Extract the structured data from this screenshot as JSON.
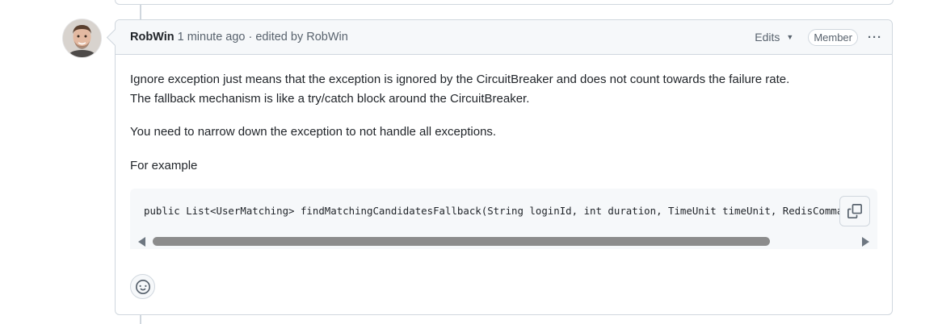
{
  "comment": {
    "author": "RobWin",
    "meta": "1 minute ago · edited by RobWin",
    "edits_label": "Edits",
    "role_badge": "Member",
    "more_actions": "···",
    "body": {
      "line1": "Ignore exception just means that the exception is ignored by the CircuitBreaker and does not count towards the failure rate.",
      "line2": "The fallback mechanism is like a try/catch block around the CircuitBreaker.",
      "paragraph2": "You need to narrow down the exception to not handle all exceptions.",
      "paragraph3": "For example",
      "code": "public List<UserMatching> findMatchingCandidatesFallback(String loginId, int duration, TimeUnit timeUnit, RedisCommandTimeoutException ex) {"
    }
  },
  "icons": {
    "copy": "copy-icon",
    "emoji": "smiley-icon",
    "caret": "triangle-down-icon",
    "kebab": "kebab-horizontal-icon"
  },
  "colors": {
    "border": "#d0d7de",
    "header_bg": "#f6f8fa",
    "muted_text": "#59636e"
  }
}
